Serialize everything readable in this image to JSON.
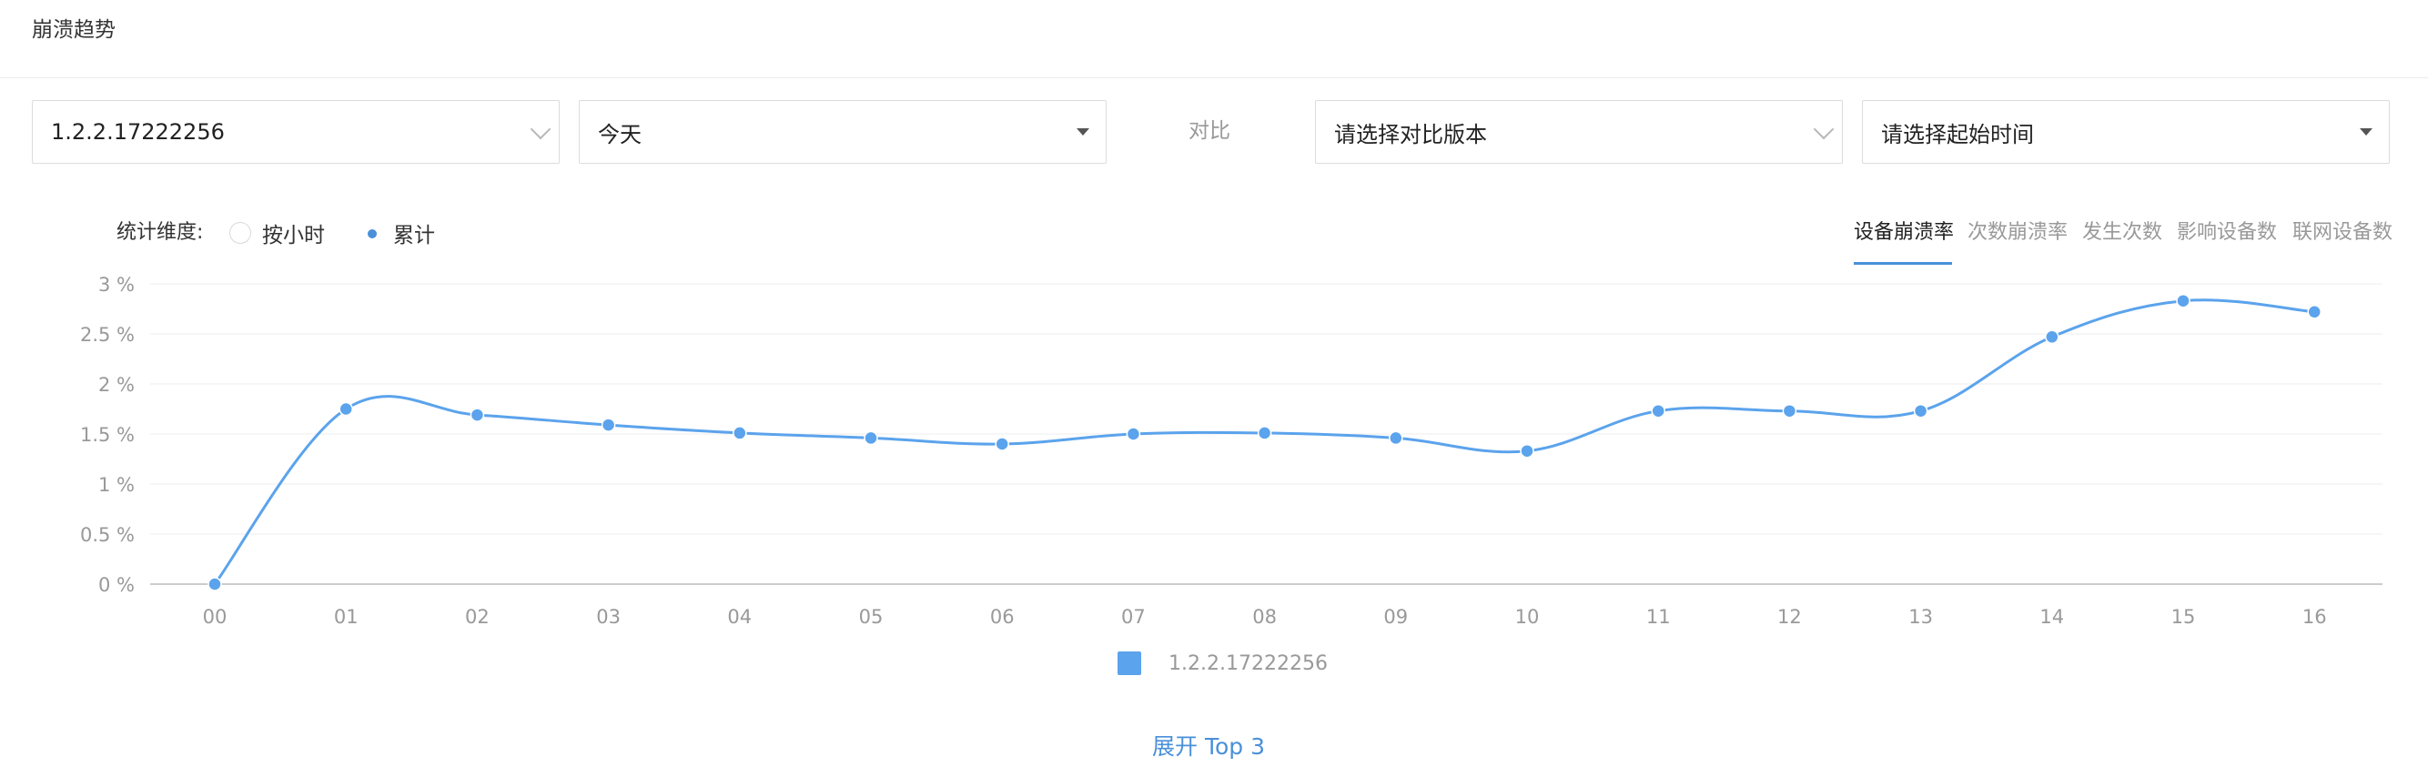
{
  "header": {
    "title": "崩溃趋势"
  },
  "filters": {
    "version_value": "1.2.2.17222256",
    "date_value": "今天",
    "compare_label": "对比",
    "compare_version_placeholder": "请选择对比版本",
    "start_time_placeholder": "请选择起始时间"
  },
  "dimension": {
    "label": "统计维度:",
    "options": [
      {
        "label": "按小时",
        "selected": false
      },
      {
        "label": "累计",
        "selected": true
      }
    ]
  },
  "metric_tabs": [
    {
      "label": "设备崩溃率",
      "active": true
    },
    {
      "label": "次数崩溃率",
      "active": false
    },
    {
      "label": "发生次数",
      "active": false
    },
    {
      "label": "影响设备数",
      "active": false
    },
    {
      "label": "联网设备数",
      "active": false
    }
  ],
  "colors": {
    "accent": "#4a90d9",
    "series": "#5ba3ec",
    "grid": "#eeeeee",
    "axis_text": "#999999"
  },
  "chart_data": {
    "type": "line",
    "title": "",
    "xlabel": "",
    "ylabel": "",
    "x": [
      "00",
      "01",
      "02",
      "03",
      "04",
      "05",
      "06",
      "07",
      "08",
      "09",
      "10",
      "11",
      "12",
      "13",
      "14",
      "15",
      "16"
    ],
    "yticks": [
      "0 %",
      "0.5 %",
      "1 %",
      "1.5 %",
      "2 %",
      "2.5 %",
      "3 %"
    ],
    "ylim": [
      0,
      3
    ],
    "grid": true,
    "smooth": true,
    "legend": "bottom-center",
    "series": [
      {
        "name": "1.2.2.17222256",
        "values": [
          0,
          1.75,
          1.69,
          1.59,
          1.51,
          1.46,
          1.4,
          1.5,
          1.51,
          1.46,
          1.33,
          1.73,
          1.73,
          1.73,
          2.47,
          2.83,
          2.72
        ]
      }
    ]
  },
  "footer": {
    "expand_label": "展开 Top 3"
  }
}
